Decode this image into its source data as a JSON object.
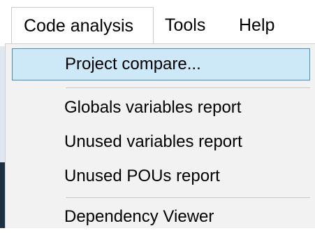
{
  "menubar": {
    "items": [
      {
        "label": "Code analysis"
      },
      {
        "label": "Tools"
      },
      {
        "label": "Help"
      }
    ]
  },
  "dropdown": {
    "items": [
      {
        "label": "Project compare..."
      },
      {
        "label": "Globals variables report"
      },
      {
        "label": "Unused variables report"
      },
      {
        "label": "Unused POUs report"
      },
      {
        "label": "Dependency Viewer"
      }
    ]
  },
  "colors": {
    "highlight_fill": "#cde8f7",
    "highlight_border": "#3f8fd2",
    "menu_background": "#f2f2f2"
  }
}
